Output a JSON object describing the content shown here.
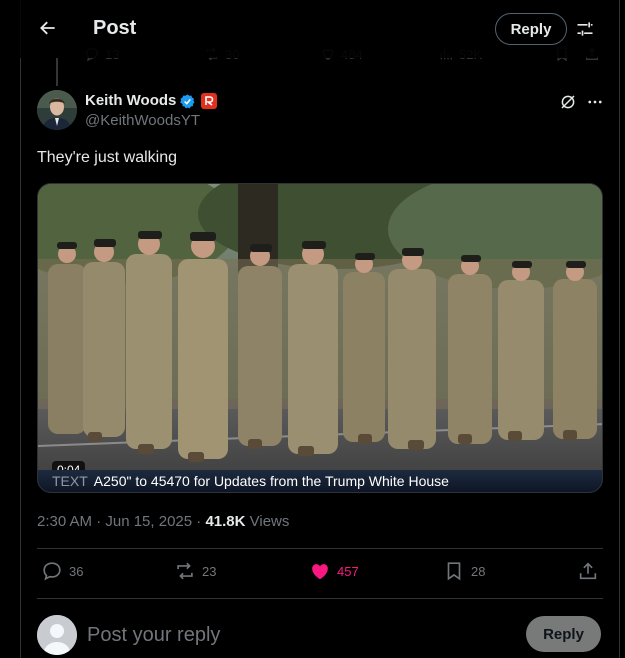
{
  "header": {
    "title": "Post",
    "reply_label": "Reply"
  },
  "prev_actions": {
    "replies": "13",
    "reposts": "30",
    "likes": "484",
    "views": "52K"
  },
  "author": {
    "name": "Keith Woods",
    "handle": "@KeithWoodsYT"
  },
  "tweet": {
    "text": "They're just walking"
  },
  "media": {
    "duration": "0:04",
    "caption_prefix": "TEXT",
    "caption": "A250\" to 45470 for Updates from the Trump White House"
  },
  "meta": {
    "timestamp": "2:30 AM · Jun 15, 2025 · ",
    "views_count": "41.8K",
    "views_label": " Views"
  },
  "actions": {
    "replies": "36",
    "reposts": "23",
    "likes": "457",
    "bookmarks": "28"
  },
  "composer": {
    "placeholder": "Post your reply",
    "button": "Reply"
  },
  "colors": {
    "like": "#f91880",
    "verified": "#1d9bf0",
    "affiliate_badge": "#e0301e",
    "muted": "#71767b",
    "text": "#e7e9ea"
  },
  "icons": [
    "back-arrow-icon",
    "tune-icon",
    "reply-icon",
    "repost-icon",
    "heart-icon",
    "bookmark-icon",
    "share-icon",
    "views-icon",
    "verified-icon",
    "grok-icon",
    "more-icon"
  ]
}
